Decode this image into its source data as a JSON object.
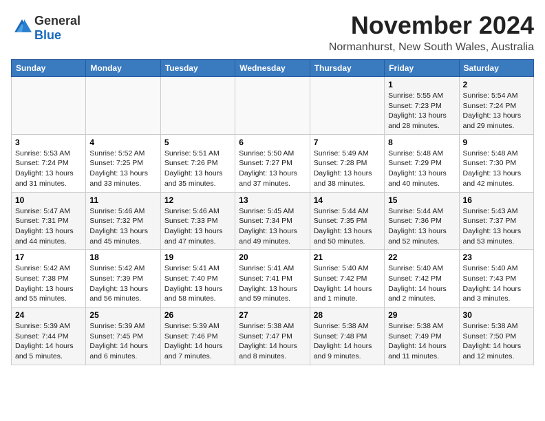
{
  "header": {
    "logo_general": "General",
    "logo_blue": "Blue",
    "month": "November 2024",
    "location": "Normanhurst, New South Wales, Australia"
  },
  "weekdays": [
    "Sunday",
    "Monday",
    "Tuesday",
    "Wednesday",
    "Thursday",
    "Friday",
    "Saturday"
  ],
  "weeks": [
    [
      {
        "day": "",
        "info": ""
      },
      {
        "day": "",
        "info": ""
      },
      {
        "day": "",
        "info": ""
      },
      {
        "day": "",
        "info": ""
      },
      {
        "day": "",
        "info": ""
      },
      {
        "day": "1",
        "info": "Sunrise: 5:55 AM\nSunset: 7:23 PM\nDaylight: 13 hours and 28 minutes."
      },
      {
        "day": "2",
        "info": "Sunrise: 5:54 AM\nSunset: 7:24 PM\nDaylight: 13 hours and 29 minutes."
      }
    ],
    [
      {
        "day": "3",
        "info": "Sunrise: 5:53 AM\nSunset: 7:24 PM\nDaylight: 13 hours and 31 minutes."
      },
      {
        "day": "4",
        "info": "Sunrise: 5:52 AM\nSunset: 7:25 PM\nDaylight: 13 hours and 33 minutes."
      },
      {
        "day": "5",
        "info": "Sunrise: 5:51 AM\nSunset: 7:26 PM\nDaylight: 13 hours and 35 minutes."
      },
      {
        "day": "6",
        "info": "Sunrise: 5:50 AM\nSunset: 7:27 PM\nDaylight: 13 hours and 37 minutes."
      },
      {
        "day": "7",
        "info": "Sunrise: 5:49 AM\nSunset: 7:28 PM\nDaylight: 13 hours and 38 minutes."
      },
      {
        "day": "8",
        "info": "Sunrise: 5:48 AM\nSunset: 7:29 PM\nDaylight: 13 hours and 40 minutes."
      },
      {
        "day": "9",
        "info": "Sunrise: 5:48 AM\nSunset: 7:30 PM\nDaylight: 13 hours and 42 minutes."
      }
    ],
    [
      {
        "day": "10",
        "info": "Sunrise: 5:47 AM\nSunset: 7:31 PM\nDaylight: 13 hours and 44 minutes."
      },
      {
        "day": "11",
        "info": "Sunrise: 5:46 AM\nSunset: 7:32 PM\nDaylight: 13 hours and 45 minutes."
      },
      {
        "day": "12",
        "info": "Sunrise: 5:46 AM\nSunset: 7:33 PM\nDaylight: 13 hours and 47 minutes."
      },
      {
        "day": "13",
        "info": "Sunrise: 5:45 AM\nSunset: 7:34 PM\nDaylight: 13 hours and 49 minutes."
      },
      {
        "day": "14",
        "info": "Sunrise: 5:44 AM\nSunset: 7:35 PM\nDaylight: 13 hours and 50 minutes."
      },
      {
        "day": "15",
        "info": "Sunrise: 5:44 AM\nSunset: 7:36 PM\nDaylight: 13 hours and 52 minutes."
      },
      {
        "day": "16",
        "info": "Sunrise: 5:43 AM\nSunset: 7:37 PM\nDaylight: 13 hours and 53 minutes."
      }
    ],
    [
      {
        "day": "17",
        "info": "Sunrise: 5:42 AM\nSunset: 7:38 PM\nDaylight: 13 hours and 55 minutes."
      },
      {
        "day": "18",
        "info": "Sunrise: 5:42 AM\nSunset: 7:39 PM\nDaylight: 13 hours and 56 minutes."
      },
      {
        "day": "19",
        "info": "Sunrise: 5:41 AM\nSunset: 7:40 PM\nDaylight: 13 hours and 58 minutes."
      },
      {
        "day": "20",
        "info": "Sunrise: 5:41 AM\nSunset: 7:41 PM\nDaylight: 13 hours and 59 minutes."
      },
      {
        "day": "21",
        "info": "Sunrise: 5:40 AM\nSunset: 7:42 PM\nDaylight: 14 hours and 1 minute."
      },
      {
        "day": "22",
        "info": "Sunrise: 5:40 AM\nSunset: 7:42 PM\nDaylight: 14 hours and 2 minutes."
      },
      {
        "day": "23",
        "info": "Sunrise: 5:40 AM\nSunset: 7:43 PM\nDaylight: 14 hours and 3 minutes."
      }
    ],
    [
      {
        "day": "24",
        "info": "Sunrise: 5:39 AM\nSunset: 7:44 PM\nDaylight: 14 hours and 5 minutes."
      },
      {
        "day": "25",
        "info": "Sunrise: 5:39 AM\nSunset: 7:45 PM\nDaylight: 14 hours and 6 minutes."
      },
      {
        "day": "26",
        "info": "Sunrise: 5:39 AM\nSunset: 7:46 PM\nDaylight: 14 hours and 7 minutes."
      },
      {
        "day": "27",
        "info": "Sunrise: 5:38 AM\nSunset: 7:47 PM\nDaylight: 14 hours and 8 minutes."
      },
      {
        "day": "28",
        "info": "Sunrise: 5:38 AM\nSunset: 7:48 PM\nDaylight: 14 hours and 9 minutes."
      },
      {
        "day": "29",
        "info": "Sunrise: 5:38 AM\nSunset: 7:49 PM\nDaylight: 14 hours and 11 minutes."
      },
      {
        "day": "30",
        "info": "Sunrise: 5:38 AM\nSunset: 7:50 PM\nDaylight: 14 hours and 12 minutes."
      }
    ]
  ]
}
